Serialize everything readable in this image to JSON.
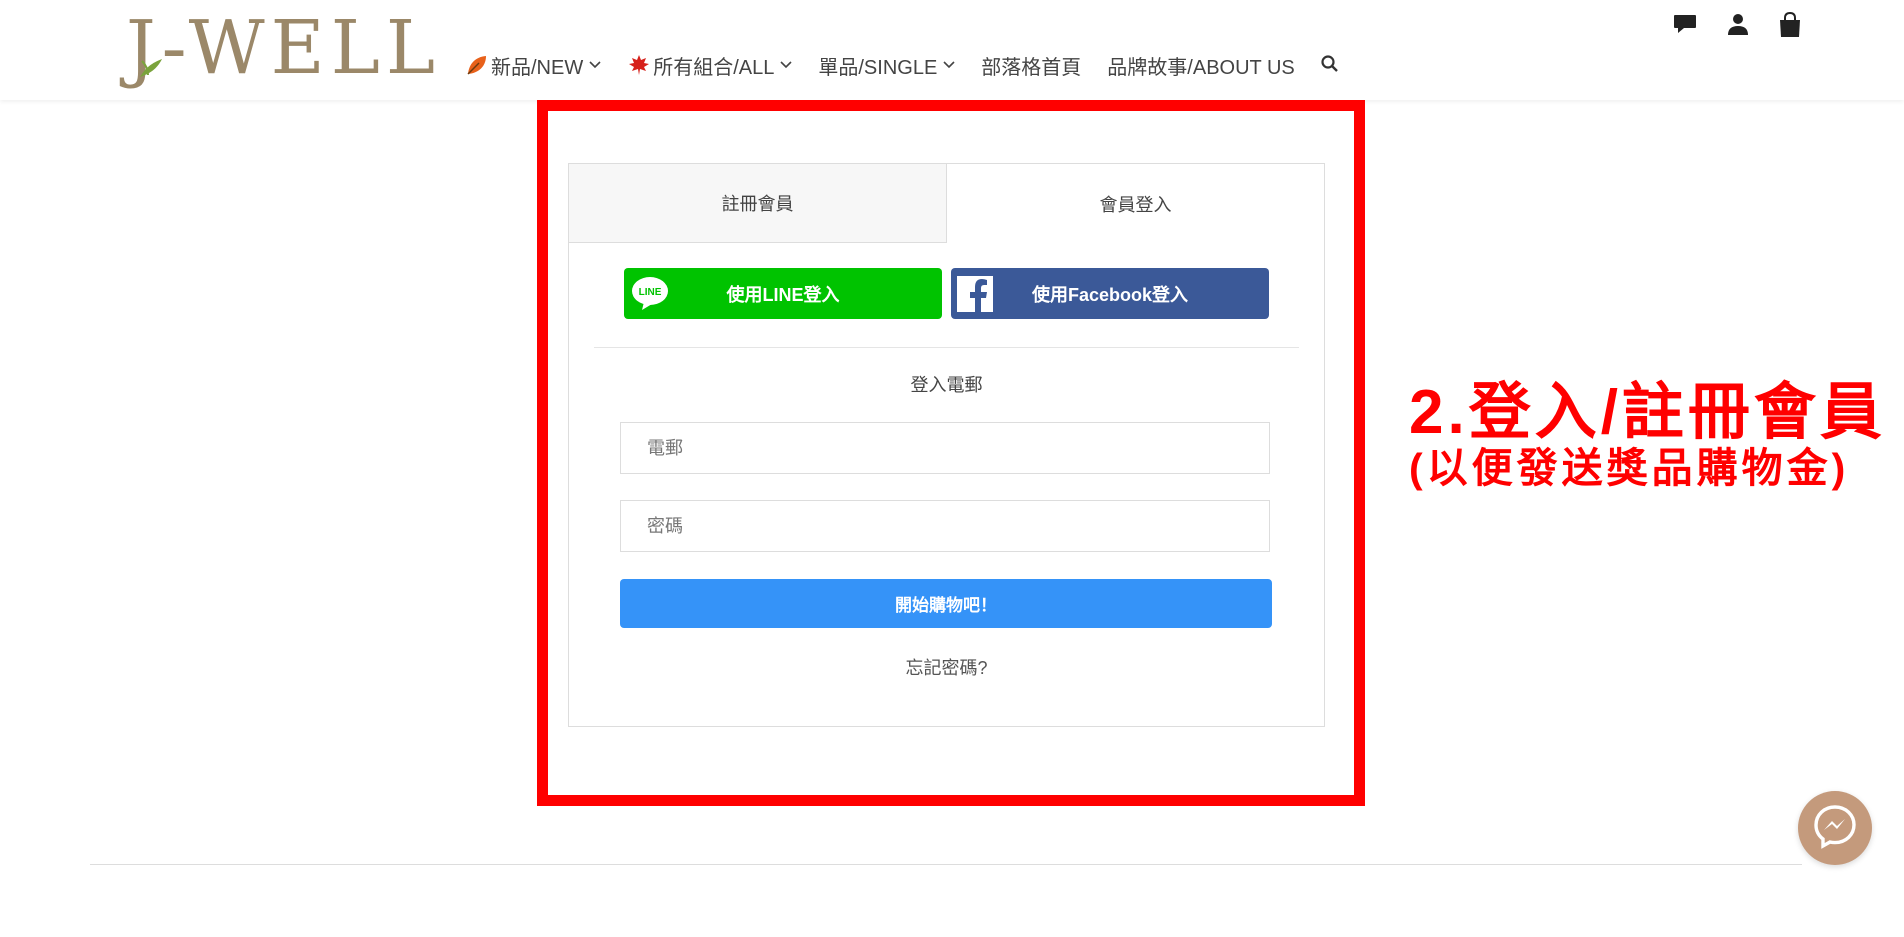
{
  "brand": {
    "logo_text": "J-WELL"
  },
  "nav": {
    "items": [
      {
        "label": "新品/NEW",
        "icon": "autumn-leaf-icon",
        "has_dropdown": true
      },
      {
        "label": "所有組合/ALL",
        "icon": "maple-leaf-icon",
        "has_dropdown": true
      },
      {
        "label": "單品/SINGLE",
        "has_dropdown": true
      },
      {
        "label": "部落格首頁",
        "has_dropdown": false
      },
      {
        "label": "品牌故事/ABOUT US",
        "has_dropdown": false
      }
    ]
  },
  "header_icons": [
    "chat-icon",
    "user-icon",
    "shopping-bag-icon",
    "search-icon"
  ],
  "auth": {
    "tabs": [
      {
        "label": "註冊會員",
        "active": false
      },
      {
        "label": "會員登入",
        "active": true
      }
    ],
    "line_button": "使用LINE登入",
    "line_icon_text": "LINE",
    "facebook_button": "使用Facebook登入",
    "email_section_label": "登入電郵",
    "email_placeholder": "電郵",
    "password_placeholder": "密碼",
    "submit_label": "開始購物吧！",
    "forgot_label": "忘記密碼?"
  },
  "annotation": {
    "title": "2.登入/註冊會員",
    "subtitle": "(以便發送獎品購物金)"
  },
  "colors": {
    "line_green": "#00c300",
    "facebook_blue": "#3b5998",
    "submit_blue": "#3593f8",
    "annotation_red": "#ff0000",
    "logo_brown": "#9b8869",
    "messenger_bg": "#c49a7c"
  }
}
